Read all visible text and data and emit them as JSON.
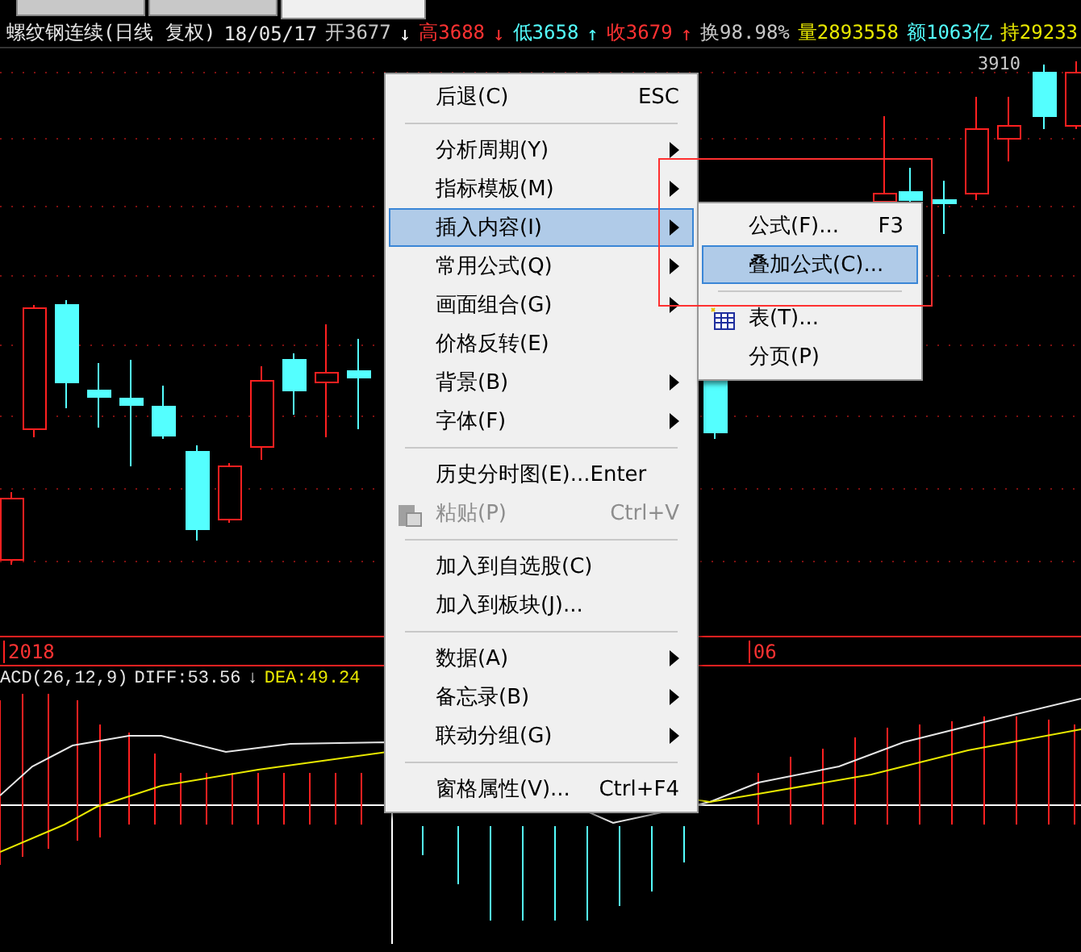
{
  "tabs": [
    {
      "selected": false
    },
    {
      "selected": false
    },
    {
      "selected": true
    }
  ],
  "info_bar": {
    "title": "螺纹钢连续(日线 复权)",
    "date": "18/05/17",
    "quotes": [
      {
        "text": "开3677",
        "color": "#c8c8c8"
      },
      {
        "text": "↓",
        "color": "#ffffff"
      },
      {
        "text": "高3688",
        "color": "#ff3232"
      },
      {
        "text": "↓",
        "color": "#ff3232"
      },
      {
        "text": "低3658",
        "color": "#54ffff"
      },
      {
        "text": "↑",
        "color": "#54ffff"
      },
      {
        "text": "收3679",
        "color": "#ff3232"
      },
      {
        "text": "↑",
        "color": "#ff3232"
      },
      {
        "text": "换98.98%",
        "color": "#c8c8c8"
      },
      {
        "text": "量2893558",
        "color": "#e8e800"
      },
      {
        "text": "额1063亿",
        "color": "#54ffff"
      },
      {
        "text": "持29233",
        "color": "#e8e800"
      }
    ]
  },
  "price_label": "3910",
  "date_axis": [
    "2018",
    "06"
  ],
  "macd": {
    "title": "ACD(26,12,9)",
    "diff": "DIFF:53.56",
    "arrow": "↓",
    "dea": "DEA:49.24"
  },
  "context_menu": [
    {
      "kind": "item",
      "label": "后退(C)",
      "shortcut": "ESC",
      "submenu": false,
      "selected": false,
      "disabled": false
    },
    {
      "kind": "separator"
    },
    {
      "kind": "item",
      "label": "分析周期(Y)",
      "submenu": true,
      "selected": false,
      "disabled": false
    },
    {
      "kind": "item",
      "label": "指标模板(M)",
      "submenu": true,
      "selected": false,
      "disabled": false
    },
    {
      "kind": "item",
      "label": "插入内容(I)",
      "submenu": true,
      "selected": true,
      "disabled": false
    },
    {
      "kind": "item",
      "label": "常用公式(Q)",
      "submenu": true,
      "selected": false,
      "disabled": false
    },
    {
      "kind": "item",
      "label": "画面组合(G)",
      "submenu": true,
      "selected": false,
      "disabled": false
    },
    {
      "kind": "item",
      "label": "价格反转(E)",
      "submenu": false,
      "selected": false,
      "disabled": false
    },
    {
      "kind": "item",
      "label": "背景(B)",
      "submenu": true,
      "selected": false,
      "disabled": false
    },
    {
      "kind": "item",
      "label": "字体(F)",
      "submenu": true,
      "selected": false,
      "disabled": false
    },
    {
      "kind": "separator"
    },
    {
      "kind": "item",
      "label": "历史分时图(E)...Enter",
      "submenu": false,
      "selected": false,
      "disabled": false
    },
    {
      "kind": "icon_item",
      "label": "粘贴(P)",
      "shortcut": "Ctrl+V",
      "submenu": false,
      "selected": false,
      "disabled": true
    },
    {
      "kind": "separator"
    },
    {
      "kind": "item",
      "label": "加入到自选股(C)",
      "submenu": false,
      "selected": false,
      "disabled": false
    },
    {
      "kind": "item",
      "label": "加入到板块(J)...",
      "submenu": false,
      "selected": false,
      "disabled": false
    },
    {
      "kind": "separator"
    },
    {
      "kind": "item",
      "label": "数据(A)",
      "submenu": true,
      "selected": false,
      "disabled": false
    },
    {
      "kind": "item",
      "label": "备忘录(B)",
      "submenu": true,
      "selected": false,
      "disabled": false
    },
    {
      "kind": "item",
      "label": "联动分组(G)",
      "submenu": true,
      "selected": false,
      "disabled": false
    },
    {
      "kind": "separator"
    },
    {
      "kind": "item",
      "label": "窗格属性(V)...",
      "shortcut": "Ctrl+F4",
      "submenu": false,
      "selected": false,
      "disabled": false
    }
  ],
  "submenu": [
    {
      "kind": "item",
      "label": "公式(F)...",
      "shortcut": "F3",
      "submenu": false,
      "selected": false,
      "disabled": false
    },
    {
      "kind": "item",
      "label": "叠加公式(C)...",
      "submenu": false,
      "selected": true,
      "disabled": false
    },
    {
      "kind": "separator"
    },
    {
      "kind": "icon_item",
      "label": "表(T)...",
      "submenu": false,
      "selected": false,
      "disabled": false
    },
    {
      "kind": "item",
      "label": "分页(P)",
      "submenu": false,
      "selected": false,
      "disabled": false
    }
  ]
}
